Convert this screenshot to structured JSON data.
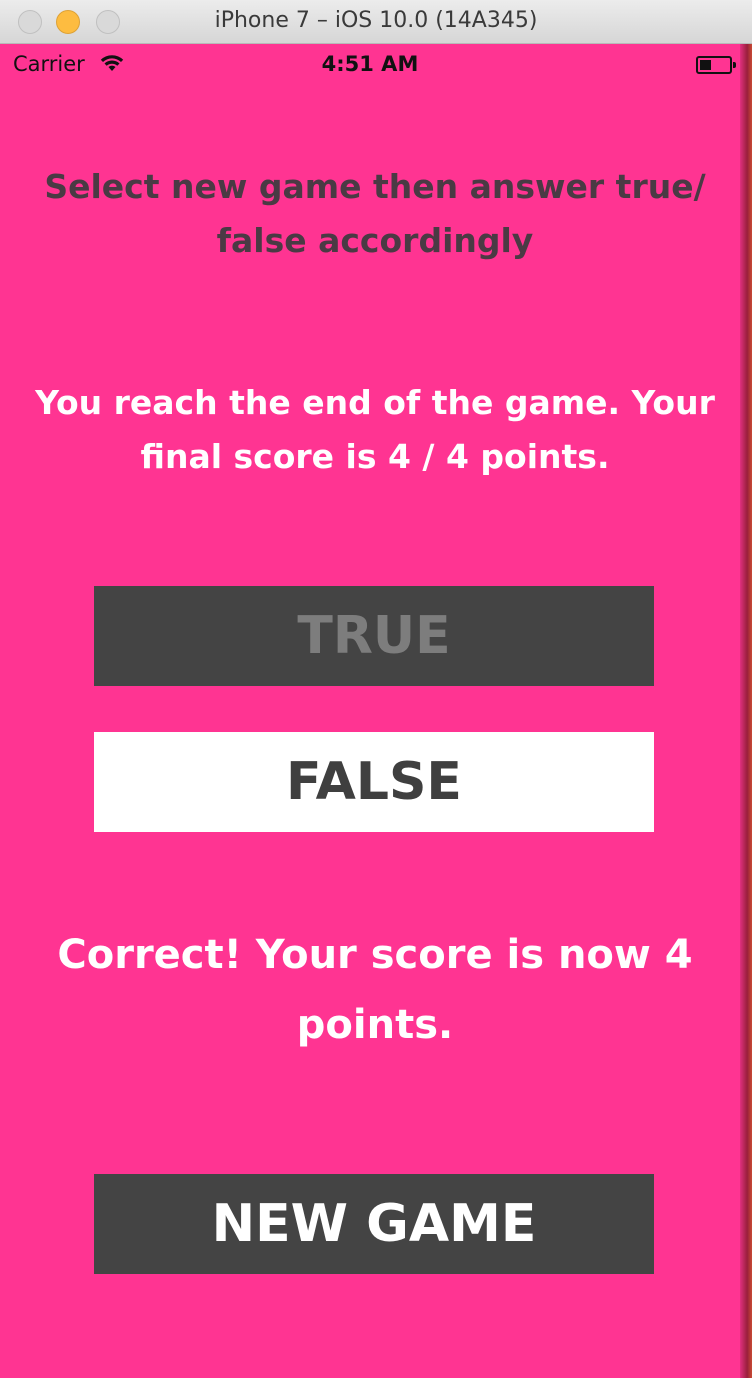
{
  "window": {
    "title": "iPhone 7 – iOS 10.0 (14A345)"
  },
  "status_bar": {
    "carrier": "Carrier",
    "time": "4:51 AM",
    "battery_level_fraction": 0.3
  },
  "app": {
    "prompt": "Select new game then answer true/ false accordingly",
    "game_over_message": "You reach the end of the game. Your final score is 4 / 4 points.",
    "true_label": "TRUE",
    "false_label": "FALSE",
    "feedback_message": "Correct! Your score is now 4 points.",
    "new_game_label": "NEW GAME"
  },
  "colors": {
    "background": "#ff3492",
    "button_dark": "#444444",
    "button_light": "#ffffff"
  }
}
